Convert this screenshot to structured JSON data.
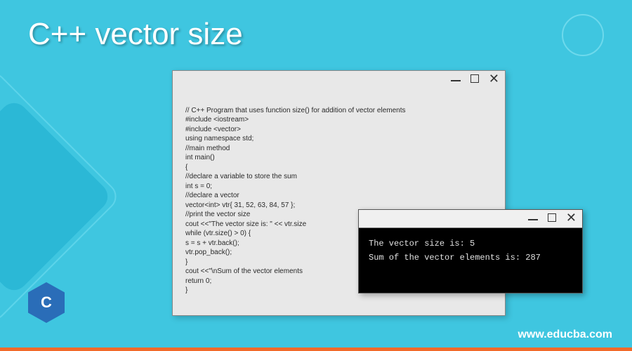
{
  "title": "C++ vector size",
  "codeWindow": {
    "lines": [
      "",
      "// C++ Program that uses function size() for addition of vector elements",
      "#include <iostream>",
      "#include <vector>",
      "using namespace std;",
      "//main method",
      "int main()",
      "{",
      "//declare a variable to store the sum",
      "int s = 0;",
      "//declare a vector",
      "vector<int> vtr{ 31, 52, 63, 84, 57 };",
      "//print the vector size",
      "cout <<\"The vector size is: \" << vtr.size",
      "while (vtr.size() > 0) {",
      "s = s + vtr.back();",
      "vtr.pop_back();",
      "}",
      "cout <<\"\\nSum of the vector elements",
      "return 0;",
      "}"
    ]
  },
  "terminalWindow": {
    "lines": [
      "The vector size is: 5",
      "Sum of the vector elements is: 287"
    ]
  },
  "logoText": "C",
  "website": "www.educba.com"
}
